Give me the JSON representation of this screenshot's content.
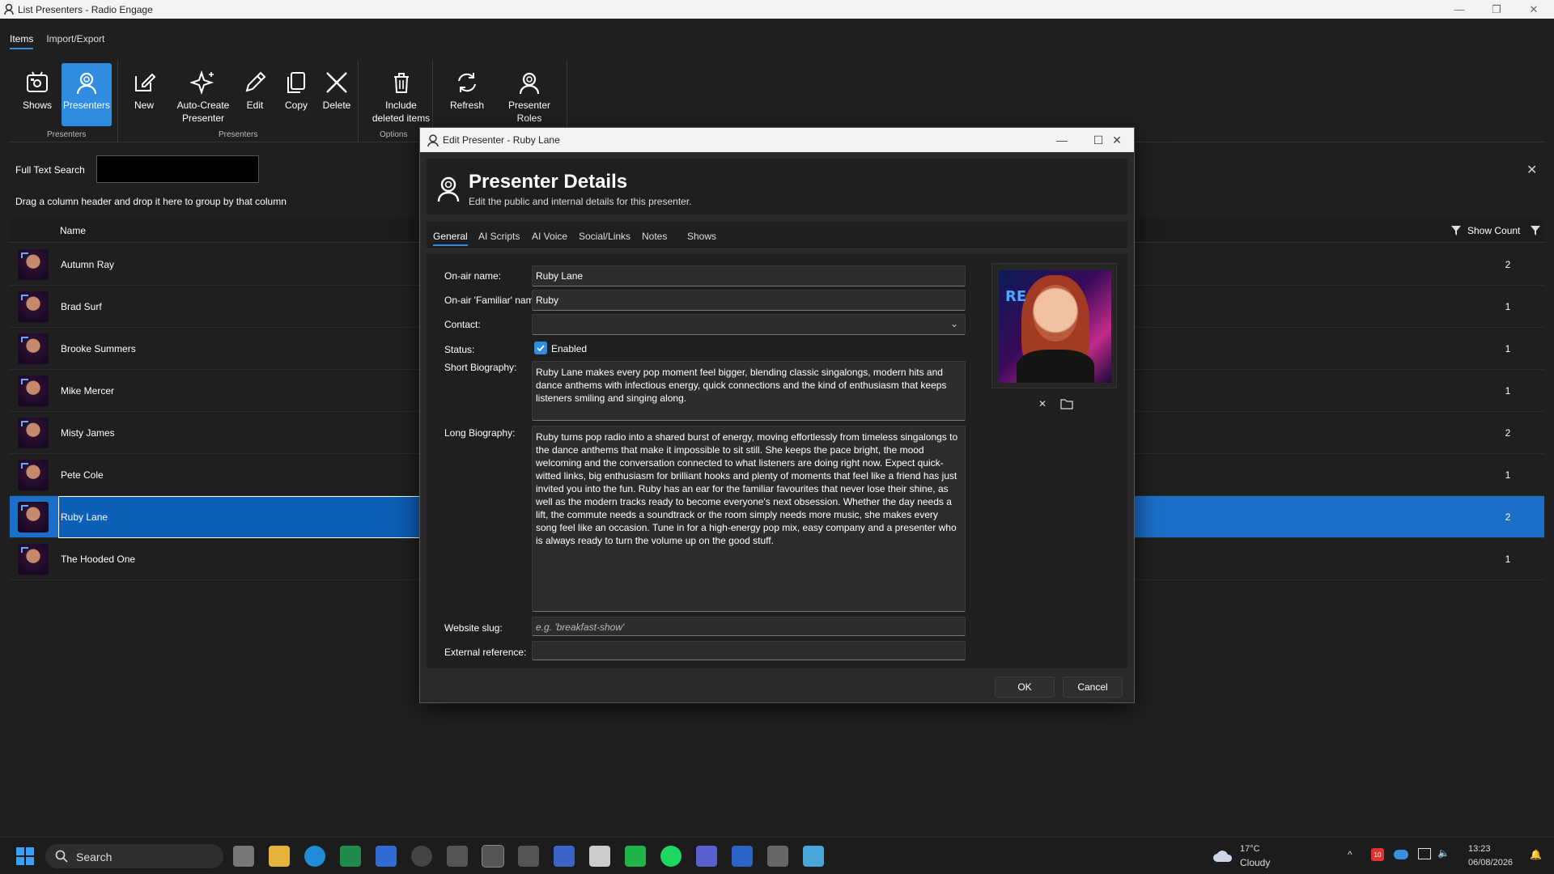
{
  "window": {
    "title": "List Presenters - Radio Engage"
  },
  "menu_tabs": [
    "Items",
    "Import/Export"
  ],
  "ribbon": {
    "buttons": [
      "Shows",
      "Presenters",
      "New",
      "Auto-Create Presenter",
      "Edit",
      "Copy",
      "Delete",
      "Include deleted items",
      "Refresh",
      "Presenter Roles"
    ],
    "groups": [
      "Presenters",
      "Presenters",
      "Options"
    ]
  },
  "search": {
    "label": "Full Text Search",
    "value": ""
  },
  "group_hint": "Drag a column header and drop it here to group by that column",
  "grid": {
    "columns": [
      "Name",
      "Show Count"
    ],
    "rows": [
      {
        "name": "Autumn Ray",
        "count": "2"
      },
      {
        "name": "Brad Surf",
        "count": "1"
      },
      {
        "name": "Brooke Summers",
        "count": "1"
      },
      {
        "name": "Mike Mercer",
        "count": "1"
      },
      {
        "name": "Misty James",
        "count": "2"
      },
      {
        "name": "Pete Cole",
        "count": "1"
      },
      {
        "name": "Ruby Lane",
        "count": "2"
      },
      {
        "name": "The Hooded One",
        "count": "1"
      }
    ],
    "selected": "Ruby Lane"
  },
  "dialog": {
    "title": "Edit Presenter - Ruby Lane",
    "heading": "Presenter Details",
    "subheading": "Edit the public and internal details for this presenter.",
    "tabs": [
      "General",
      "AI Scripts",
      "AI Voice",
      "Social/Links",
      "Notes",
      "Shows"
    ],
    "fields": {
      "on_air_name_label": "On-air name:",
      "on_air_name": "Ruby Lane",
      "familiar_label": "On-air 'Familiar' name:",
      "familiar": "Ruby",
      "contact_label": "Contact:",
      "contact": "",
      "status_label": "Status:",
      "status": "Enabled",
      "short_bio_label": "Short Biography:",
      "short_bio": "Ruby Lane makes every pop moment feel bigger, blending classic singalongs, modern hits and dance anthems with infectious energy, quick connections and the kind of enthusiasm that keeps listeners smiling and singing along.",
      "long_bio_label": "Long Biography:",
      "long_bio": "Ruby turns pop radio into a shared burst of energy, moving effortlessly from timeless singalongs to the dance anthems that make it impossible to sit still. She keeps the pace bright, the mood welcoming and the conversation connected to what listeners are doing right now. Expect quick-witted links, big enthusiasm for brilliant hooks and plenty of moments that feel like a friend has just invited you into the fun. Ruby has an ear for the familiar favourites that never lose their shine, as well as the modern tracks ready to become everyone's next obsession. Whether the day needs a lift, the commute needs a soundtrack or the room simply needs more music, she makes every song feel like an occasion. Tune in for a high-energy pop mix, easy company and a presenter who is always ready to turn the volume up on the good stuff.",
      "slug_label": "Website slug:",
      "slug_placeholder": "e.g. 'breakfast-show'",
      "extref_label": "External reference:",
      "extref": ""
    },
    "photo_logo": "RE",
    "ok": "OK",
    "cancel": "Cancel"
  },
  "taskbar": {
    "search": "Search",
    "weather_temp": "17°C",
    "weather_desc": "Cloudy",
    "time": "13:23",
    "date": "06/08/2026",
    "badge": "10"
  },
  "colors": {
    "accent": "#2f8ce0",
    "selected_row": "#1b6fc9"
  }
}
